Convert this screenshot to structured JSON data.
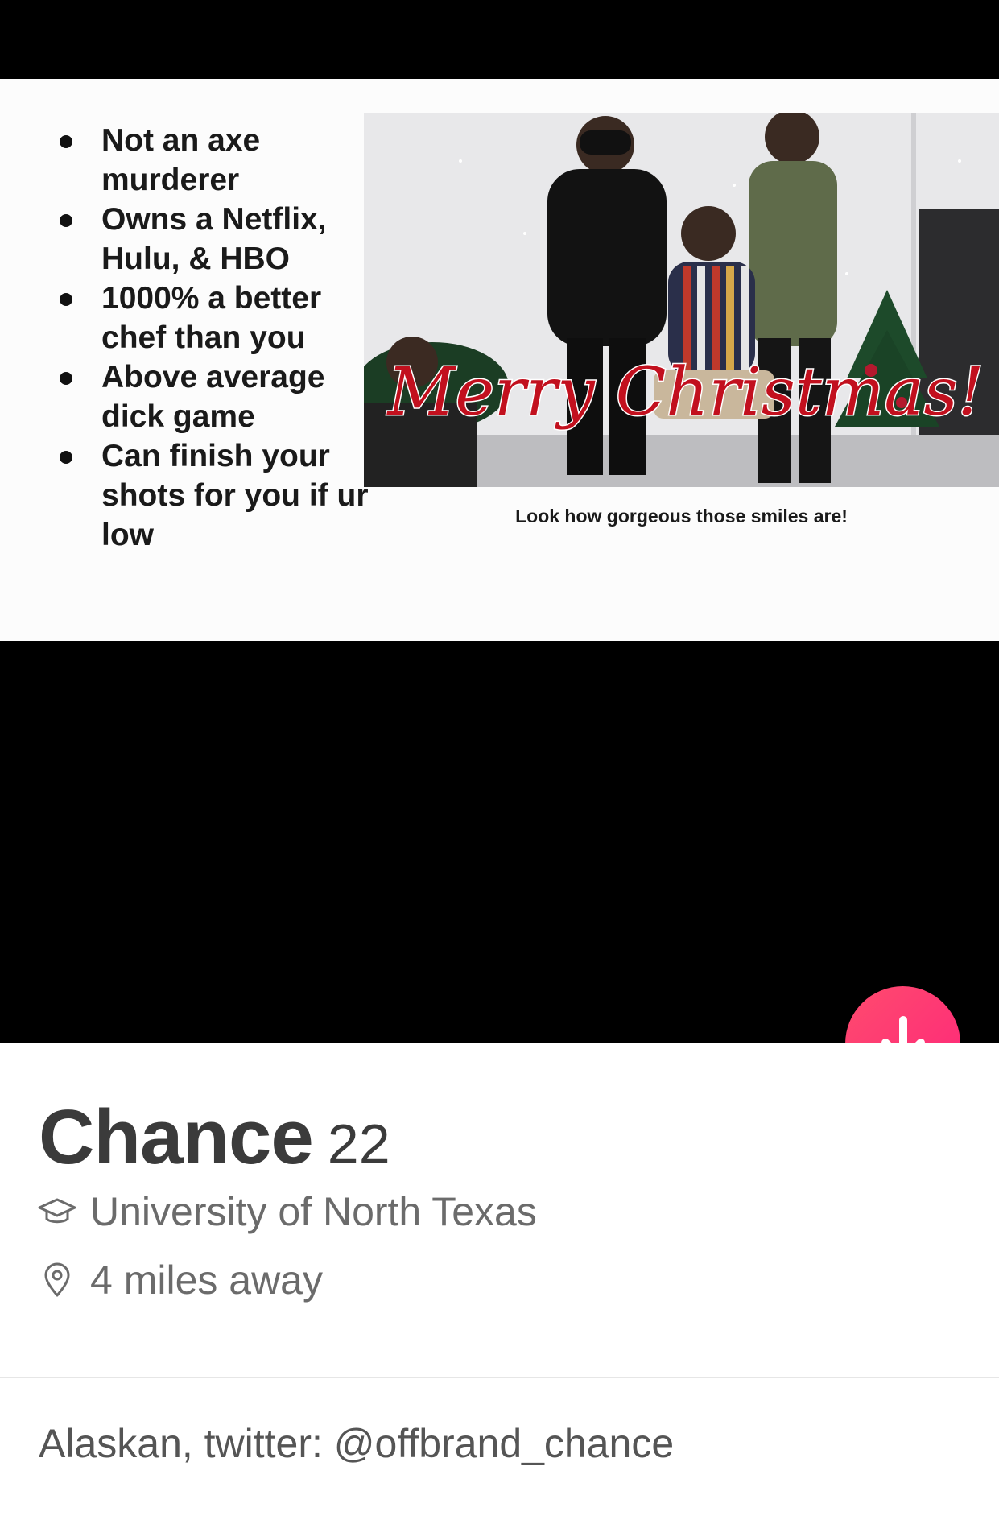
{
  "slide": {
    "bullets": [
      "Not an axe murderer",
      "Owns a Netflix, Hulu, & HBO",
      "1000% a better chef than you",
      "Above average dick game",
      "Can finish your shots for you if ur low"
    ],
    "photo_overlay_text": "Merry Christmas!",
    "caption": "Look how gorgeous those smiles are!"
  },
  "profile": {
    "name": "Chance",
    "age": "22",
    "school": "University of North Texas",
    "distance": "4 miles away",
    "bio": "Alaskan, twitter: @offbrand_chance"
  },
  "icons": {
    "fab": "arrow-down-icon",
    "school": "graduation-cap-icon",
    "distance": "location-pin-icon"
  },
  "colors": {
    "fab_start": "#ff4b6e",
    "fab_end": "#fd267a",
    "name_text": "#3b3b3b",
    "meta_text": "#6b6b6b"
  }
}
